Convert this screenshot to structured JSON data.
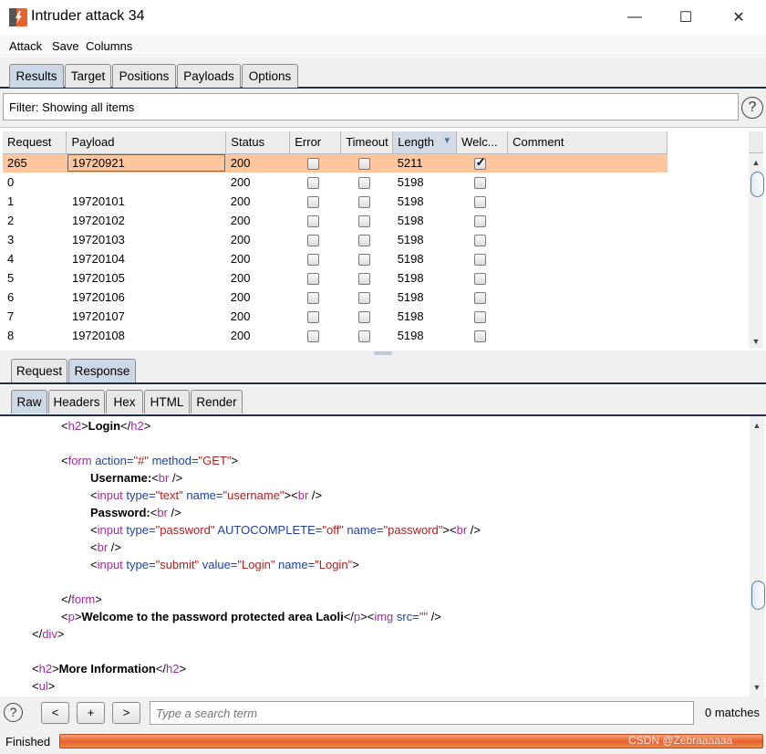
{
  "window": {
    "title": "Intruder attack 34",
    "minimize": "—",
    "maximize": "☐",
    "close": "✕"
  },
  "menu": [
    "Attack",
    "Save",
    "Columns"
  ],
  "main_tabs": [
    "Results",
    "Target",
    "Positions",
    "Payloads",
    "Options"
  ],
  "filter": {
    "text": "Filter: Showing all items",
    "help": "?"
  },
  "table": {
    "columns": [
      "Request",
      "Payload",
      "Status",
      "Error",
      "Timeout",
      "Length",
      "Welc...",
      "Comment"
    ],
    "sort_indicator": "▼",
    "rows": [
      {
        "request": "265",
        "payload": "19720921",
        "status": "200",
        "error": false,
        "timeout": false,
        "length": "5211",
        "welc": true,
        "selected": true
      },
      {
        "request": "0",
        "payload": "",
        "status": "200",
        "error": false,
        "timeout": false,
        "length": "5198",
        "welc": false
      },
      {
        "request": "1",
        "payload": "19720101",
        "status": "200",
        "error": false,
        "timeout": false,
        "length": "5198",
        "welc": false
      },
      {
        "request": "2",
        "payload": "19720102",
        "status": "200",
        "error": false,
        "timeout": false,
        "length": "5198",
        "welc": false
      },
      {
        "request": "3",
        "payload": "19720103",
        "status": "200",
        "error": false,
        "timeout": false,
        "length": "5198",
        "welc": false
      },
      {
        "request": "4",
        "payload": "19720104",
        "status": "200",
        "error": false,
        "timeout": false,
        "length": "5198",
        "welc": false
      },
      {
        "request": "5",
        "payload": "19720105",
        "status": "200",
        "error": false,
        "timeout": false,
        "length": "5198",
        "welc": false
      },
      {
        "request": "6",
        "payload": "19720106",
        "status": "200",
        "error": false,
        "timeout": false,
        "length": "5198",
        "welc": false
      },
      {
        "request": "7",
        "payload": "19720107",
        "status": "200",
        "error": false,
        "timeout": false,
        "length": "5198",
        "welc": false
      },
      {
        "request": "8",
        "payload": "19720108",
        "status": "200",
        "error": false,
        "timeout": false,
        "length": "5198",
        "welc": false
      }
    ]
  },
  "rr_tabs": [
    "Request",
    "Response"
  ],
  "view_tabs": [
    "Raw",
    "Headers",
    "Hex",
    "HTML",
    "Render"
  ],
  "code": {
    "l1": {
      "o": "<",
      "t": "h2",
      "c": ">",
      "b": "Login",
      "o2": "</",
      "t2": "h2",
      "c2": ">"
    },
    "l2": {
      "o": "<",
      "t": "form",
      "a1": " action=",
      "v1": "\"#\"",
      "a2": " method=",
      "v2": "\"GET\"",
      "c": ">"
    },
    "l3": {
      "b": "Username:",
      "o": "<",
      "t": "br",
      "c": " />"
    },
    "l4": {
      "o": "<",
      "t": "input",
      "a1": " type=",
      "v1": "\"text\"",
      "a2": " name=",
      "v2": "\"username\"",
      "c": ">",
      "o2": "<",
      "t2": "br",
      "c2": " />"
    },
    "l5": {
      "b": "Password:",
      "o": "<",
      "t": "br",
      "c": " />"
    },
    "l6": {
      "o": "<",
      "t": "input",
      "a1": " type=",
      "v1": "\"password\"",
      "a2": " AUTOCOMPLETE=",
      "v2": "\"off\"",
      "a3": " name=",
      "v3": "\"password\"",
      "c": ">",
      "o2": "<",
      "t2": "br",
      "c2": " />"
    },
    "l7": {
      "o": "<",
      "t": "br",
      "c": " />"
    },
    "l8": {
      "o": "<",
      "t": "input",
      "a1": " type=",
      "v1": "\"submit\"",
      "a2": " value=",
      "v2": "\"Login\"",
      "a3": " name=",
      "v3": "\"Login\"",
      "c": ">"
    },
    "l9": {
      "o": "</",
      "t": "form",
      "c": ">"
    },
    "l10": {
      "o": "<",
      "t": "p",
      "c": ">",
      "b": "Welcome to the password protected area Laoli",
      "o2": "</",
      "t2": "p",
      "c2": ">",
      "o3": "<",
      "t3": "img",
      "a1": " src=",
      "v1": "\"\"",
      "c3": " />"
    },
    "l11": {
      "o": "</",
      "t": "div",
      "c": ">"
    },
    "l12": {
      "o": "<",
      "t": "h2",
      "c": ">",
      "b": "More Information",
      "o2": "</",
      "t2": "h2",
      "c2": ">"
    },
    "l13": {
      "o": "<",
      "t": "ul",
      "c": ">"
    }
  },
  "search": {
    "help": "?",
    "prev": "<",
    "add": "+",
    "next": ">",
    "placeholder": "Type a search term",
    "matches": "0 matches"
  },
  "status": {
    "text": "Finished",
    "progress": 1.0,
    "watermark": "CSDN @Zebraaaaaa"
  },
  "colors": {
    "selected_row": "#ffc59c",
    "progress": "#e8602c",
    "tag": "#a12ca1",
    "attr": "#2040a0",
    "value": "#b02020"
  }
}
